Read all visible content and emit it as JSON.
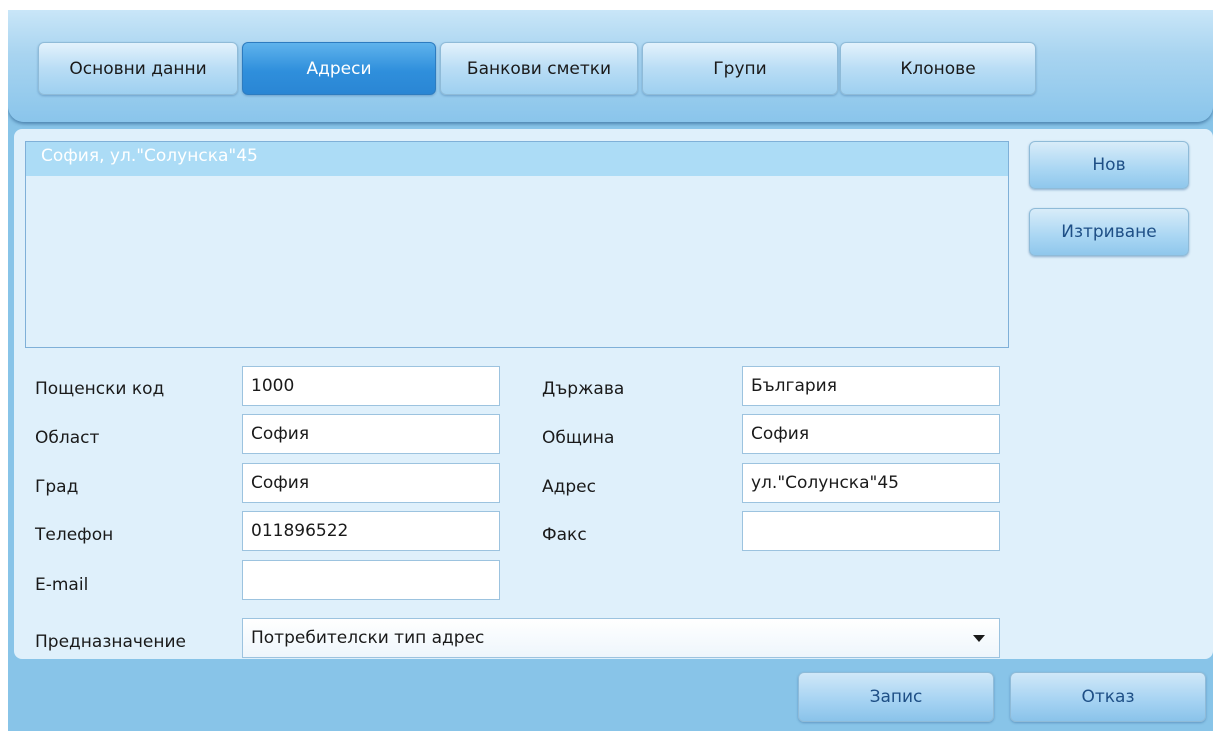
{
  "tabs": [
    {
      "label": "Основни данни",
      "active": false
    },
    {
      "label": "Адреси",
      "active": true
    },
    {
      "label": "Банкови сметки",
      "active": false
    },
    {
      "label": "Групи",
      "active": false
    },
    {
      "label": "Клонове",
      "active": false
    }
  ],
  "address_list": {
    "items": [
      "София, ул.\"Солунска\"45"
    ],
    "selected_index": 0
  },
  "side_buttons": {
    "new_label": "Нов",
    "delete_label": "Изтриване"
  },
  "form": {
    "postal_code": {
      "label": "Пощенски код",
      "value": "1000"
    },
    "region": {
      "label": "Област",
      "value": "София"
    },
    "city": {
      "label": "Град",
      "value": "София"
    },
    "phone": {
      "label": "Телефон",
      "value": "011896522"
    },
    "email": {
      "label": "E-mail",
      "value": ""
    },
    "country": {
      "label": "Държава",
      "value": "България"
    },
    "municipality": {
      "label": "Община",
      "value": "София"
    },
    "address": {
      "label": "Адрес",
      "value": "ул.\"Солунска\"45"
    },
    "fax": {
      "label": "Факс",
      "value": ""
    },
    "purpose": {
      "label": "Предназначение",
      "value": "Потребителски тип адрес"
    }
  },
  "footer": {
    "save_label": "Запис",
    "cancel_label": "Отказ"
  },
  "colors": {
    "active_tab": "#2f8fdc",
    "window_bg": "#88c4e8",
    "panel_bg": "#dff0fb",
    "selected_row": "#acdcf6"
  }
}
